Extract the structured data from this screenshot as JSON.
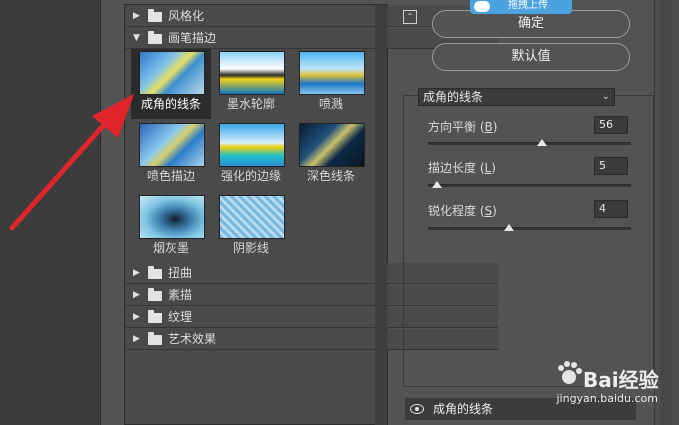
{
  "filter_gallery": {
    "folders_top": [
      {
        "label": "风格化",
        "expanded": false
      }
    ],
    "open_folder": {
      "label": "画笔描边",
      "expanded": true
    },
    "thumbnails": [
      {
        "label": "成角的线条",
        "selected": true
      },
      {
        "label": "墨水轮廓",
        "selected": false
      },
      {
        "label": "喷溅",
        "selected": false
      },
      {
        "label": "喷色描边",
        "selected": false
      },
      {
        "label": "强化的边缘",
        "selected": false
      },
      {
        "label": "深色线条",
        "selected": false
      },
      {
        "label": "烟灰墨",
        "selected": false
      },
      {
        "label": "阴影线",
        "selected": false
      }
    ],
    "folders_bottom": [
      {
        "label": "扭曲"
      },
      {
        "label": "素描"
      },
      {
        "label": "纹理"
      },
      {
        "label": "艺术效果"
      }
    ]
  },
  "buttons": {
    "ok_label": "确定",
    "default_label": "默认值",
    "collapse_icon": "collapse-up-icon"
  },
  "upload_badge": {
    "label": "拖拽上传"
  },
  "settings": {
    "selected_filter": "成角的线条",
    "params": [
      {
        "label": "方向平衡 (",
        "key": "B",
        "value": "56",
        "min": 0,
        "max": 100,
        "level": 56
      },
      {
        "label": "描边长度 (",
        "key": "L",
        "value": "5",
        "min": 3,
        "max": 50,
        "level": 5
      },
      {
        "label": "锐化程度 (",
        "key": "S",
        "value": "4",
        "min": 0,
        "max": 10,
        "level": 4
      }
    ]
  },
  "layer": {
    "label": "成角的线条",
    "visible": true
  },
  "watermark": {
    "brand": "Bai经验",
    "url": "jingyan.baidu.com"
  },
  "colors": {
    "background": "#535353",
    "panel": "#4a4a4a",
    "arrow": "#e0262a",
    "badge": "#4aa3df"
  }
}
